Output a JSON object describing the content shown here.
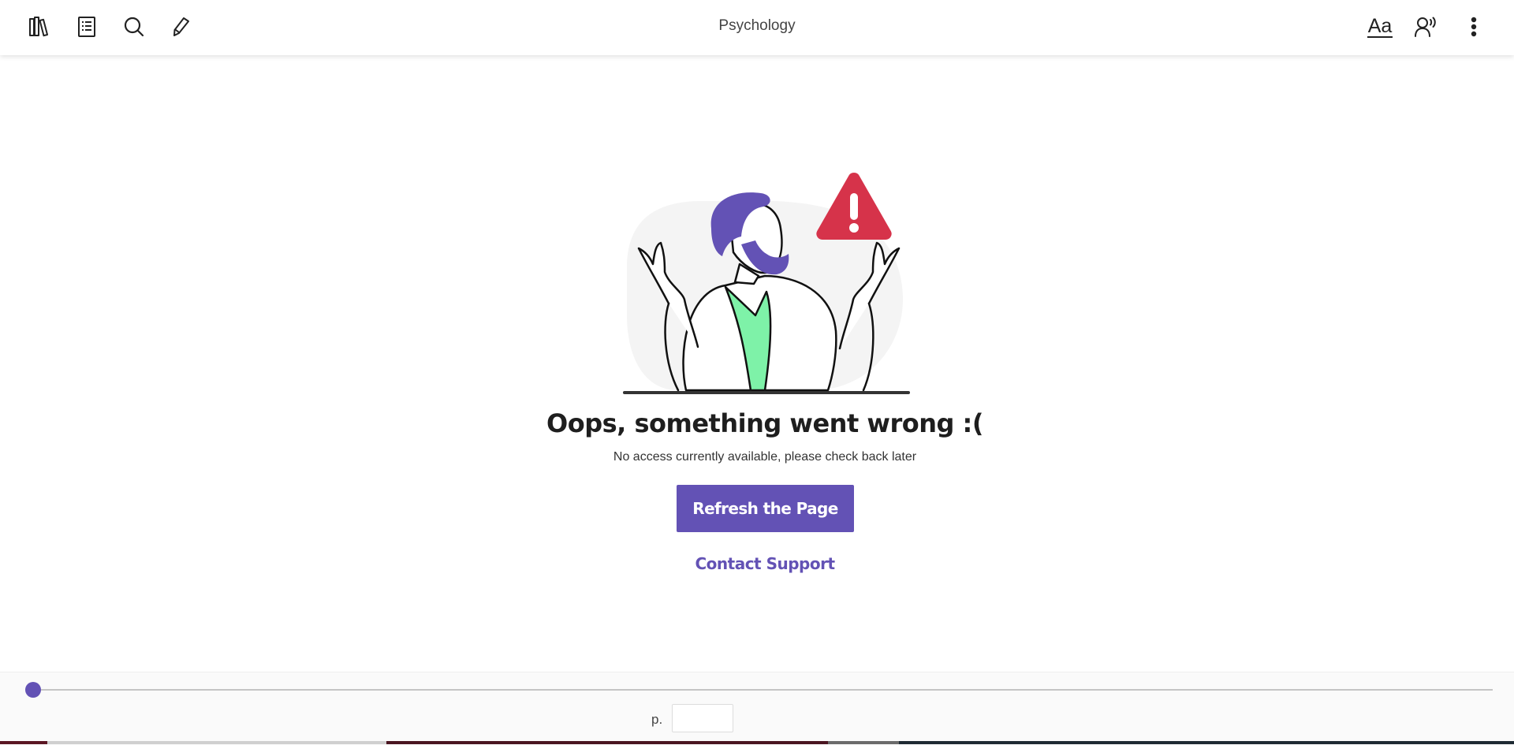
{
  "header": {
    "title": "Psychology",
    "left_icons": [
      "library-icon",
      "contents-icon",
      "search-icon",
      "pencil-icon"
    ],
    "font_settings_label": "Aa",
    "right_icons": [
      "read-aloud-icon",
      "more-vertical-icon"
    ]
  },
  "error": {
    "title": "Oops, something went wrong :(",
    "subtitle": "No access currently available, please check back later",
    "refresh_label": "Refresh the Page",
    "contact_label": "Contact Support"
  },
  "footer": {
    "page_prefix": "p.",
    "page_value": "",
    "progress": 0
  },
  "colors": {
    "accent": "#6352b5",
    "warning": "#d6334a",
    "shirt": "#7ef2a8",
    "blob": "#f4f4f4"
  }
}
